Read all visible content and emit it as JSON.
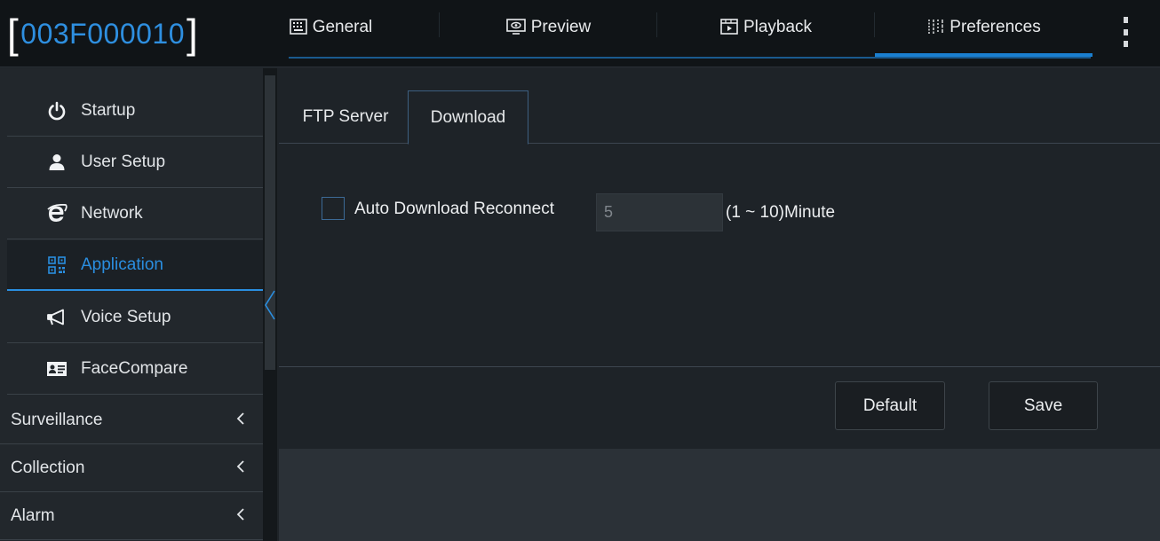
{
  "header": {
    "device_id": "003F000010",
    "tabs": [
      {
        "label": "General",
        "icon": "keyboard-icon"
      },
      {
        "label": "Preview",
        "icon": "monitor-icon"
      },
      {
        "label": "Playback",
        "icon": "film-icon"
      },
      {
        "label": "Preferences",
        "icon": "sliders-icon"
      }
    ],
    "active_tab": "Preferences"
  },
  "sidebar": {
    "items": [
      {
        "label": "Startup",
        "icon": "power-icon"
      },
      {
        "label": "User Setup",
        "icon": "user-icon"
      },
      {
        "label": "Network",
        "icon": "internet-explorer-icon"
      },
      {
        "label": "Application",
        "icon": "qr-code-icon"
      },
      {
        "label": "Voice Setup",
        "icon": "megaphone-icon"
      },
      {
        "label": "FaceCompare",
        "icon": "id-card-icon"
      }
    ],
    "active_item": "Application",
    "categories": [
      {
        "label": "Surveillance"
      },
      {
        "label": "Collection"
      },
      {
        "label": "Alarm"
      }
    ]
  },
  "main": {
    "subtabs": [
      {
        "label": "FTP Server"
      },
      {
        "label": "Download"
      }
    ],
    "active_subtab": "Download",
    "auto_download": {
      "label": "Auto Download Reconnect",
      "checked": false,
      "value": "5",
      "range_label": "(1 ~ 10)Minute"
    },
    "buttons": {
      "default_label": "Default",
      "save_label": "Save"
    }
  },
  "colors": {
    "accent": "#2a8ee0",
    "background": "#1e2328",
    "topbar": "#101417"
  }
}
